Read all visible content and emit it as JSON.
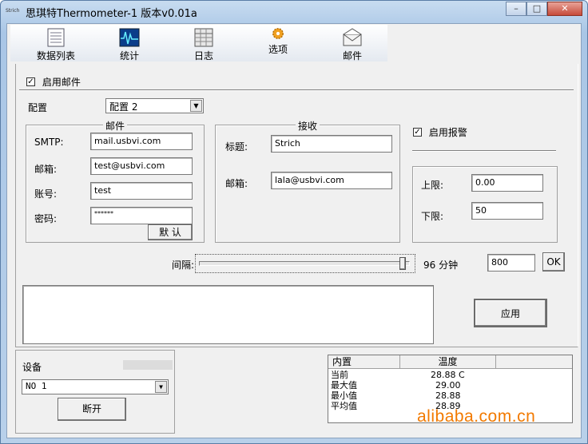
{
  "window": {
    "app_icon_text": "Strich",
    "title": "思琪特Thermometer-1 版本v0.01a",
    "controls": [
      "–",
      "□",
      "✕"
    ]
  },
  "toolbar": {
    "items": [
      {
        "label": "数据列表",
        "icon": "data-list-icon"
      },
      {
        "label": "统计",
        "icon": "statistics-icon"
      },
      {
        "label": "日志",
        "icon": "log-icon"
      },
      {
        "label": "选项",
        "icon": "options-icon"
      },
      {
        "label": "邮件",
        "icon": "mail-icon"
      }
    ]
  },
  "mail": {
    "enable_label": "启用邮件",
    "enable_checked": true,
    "config_label": "配置",
    "config_value": "配置 2",
    "group_title": "邮件",
    "smtp_label": "SMTP:",
    "smtp_value": "mail.usbvi.com",
    "mailbox_label": "邮箱:",
    "mailbox_value": "test@usbvi.com",
    "account_label": "账号:",
    "account_value": "test",
    "password_label": "密码:",
    "password_value": "******",
    "default_button": "默 认"
  },
  "receive": {
    "group_title": "接收",
    "subject_label": "标题:",
    "subject_value": "Strich",
    "mailbox_label": "邮箱:",
    "mailbox_value": "lala@usbvi.com"
  },
  "alarm": {
    "enable_label": "启用报警",
    "enable_checked": true,
    "upper_label": "上限:",
    "upper_value": "0.00",
    "lower_label": "下限:",
    "lower_value": "50"
  },
  "interval": {
    "label": "间隔:",
    "readout": "96 分钟",
    "input_value": "800",
    "ok_button": "OK",
    "slider_level": 0.98
  },
  "apply_button": "应用",
  "device": {
    "label": "设备",
    "selected": "NO 1",
    "disconnect_button": "断开"
  },
  "readings": {
    "headers": [
      "内置",
      "温度"
    ],
    "rows": [
      {
        "name": "当前",
        "value": "28.88 C"
      },
      {
        "name": "最大值",
        "value": "29.00"
      },
      {
        "name": "最小值",
        "value": "28.88"
      },
      {
        "name": "平均值",
        "value": "28.89"
      }
    ]
  },
  "watermark": "alibaba.com.cn"
}
